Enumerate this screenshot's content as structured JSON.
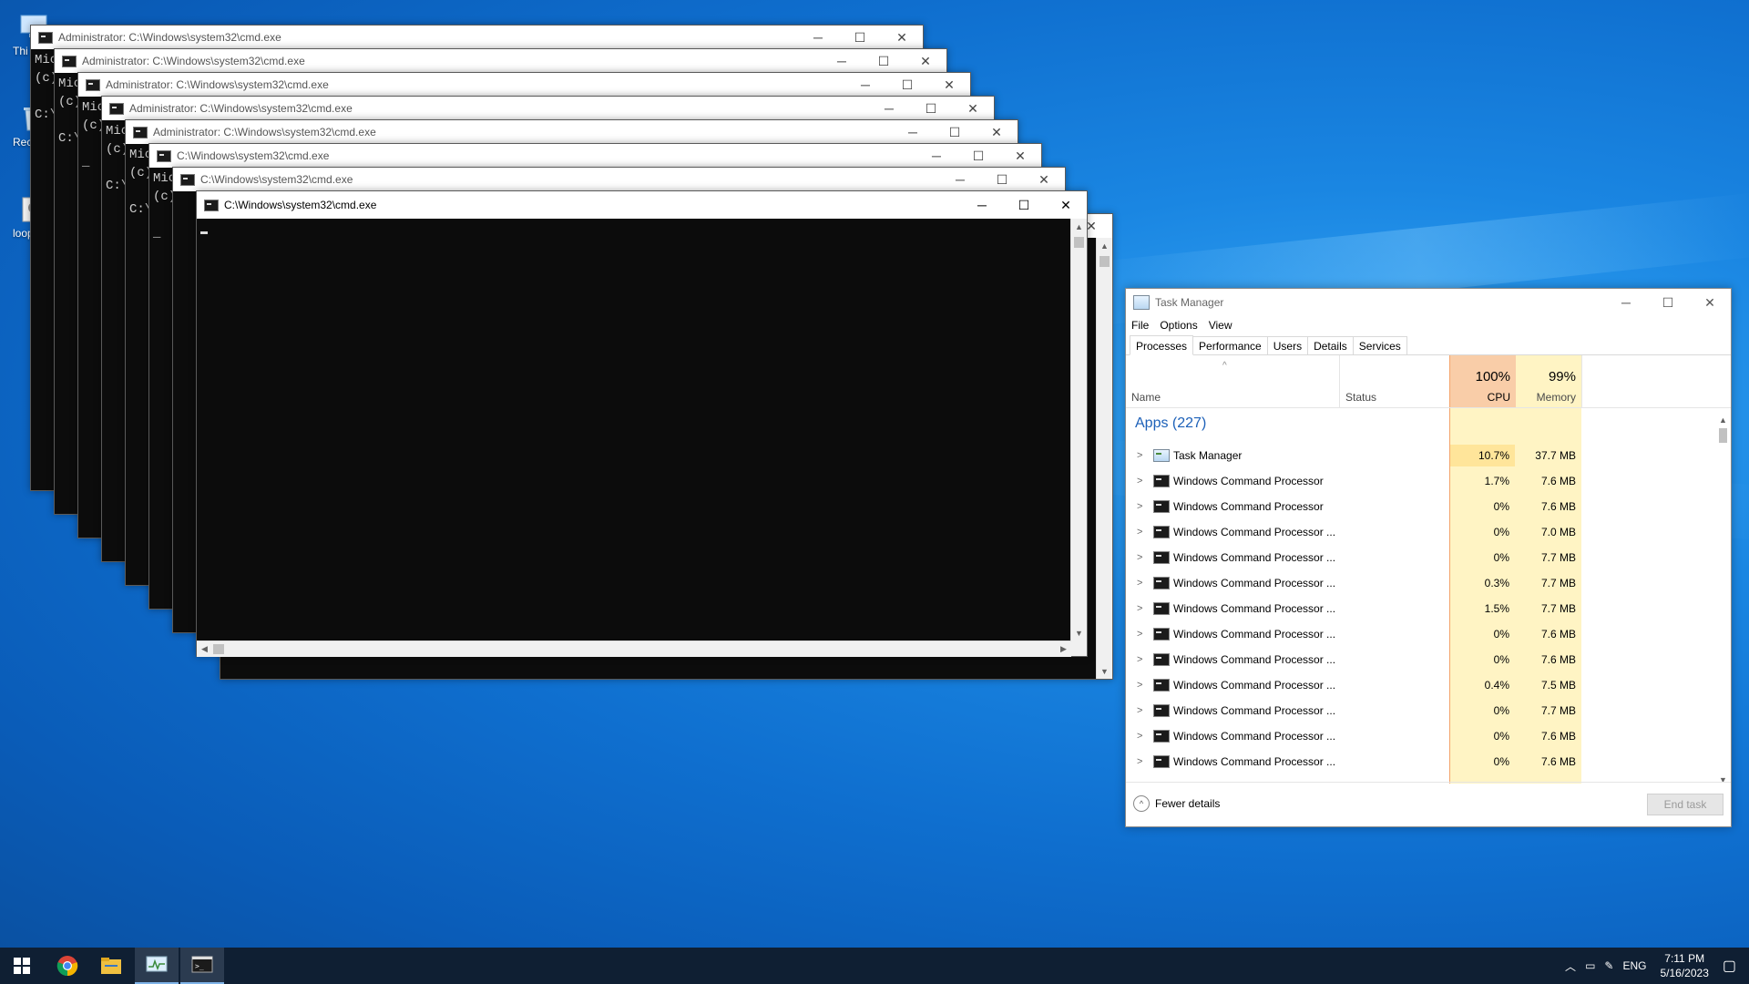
{
  "desktop_icons": [
    {
      "label": "Thi",
      "icon": "this-pc-icon"
    },
    {
      "label": "Recy",
      "icon": "recycle-bin-icon"
    },
    {
      "label": "loop",
      "icon": "file-icon"
    }
  ],
  "cmd_windows": [
    {
      "title": "Administrator: C:\\Windows\\system32\\cmd.exe",
      "lines": [
        "Mic",
        "(c)",
        "",
        "C:\\"
      ]
    },
    {
      "title": "Administrator: C:\\Windows\\system32\\cmd.exe",
      "lines": [
        "Mic",
        "(c)",
        "",
        "C:\\"
      ]
    },
    {
      "title": "Administrator: C:\\Windows\\system32\\cmd.exe",
      "lines": [
        "Mic",
        "(c)",
        "",
        "_"
      ]
    },
    {
      "title": "Administrator: C:\\Windows\\system32\\cmd.exe",
      "lines": [
        "Mic",
        "(c)",
        "",
        "C:\\"
      ]
    },
    {
      "title": "Administrator: C:\\Windows\\system32\\cmd.exe",
      "lines": [
        "Mic",
        "(c)",
        "",
        "C:\\"
      ]
    },
    {
      "title": "C:\\Windows\\system32\\cmd.exe",
      "lines": [
        "Mic",
        "(c)",
        "",
        "_"
      ]
    },
    {
      "title": "C:\\Windows\\system32\\cmd.exe",
      "lines": []
    },
    {
      "title": "C:\\Windows\\system32\\cmd.exe",
      "lines": []
    }
  ],
  "task_manager": {
    "title": "Task Manager",
    "menu": [
      "File",
      "Options",
      "View"
    ],
    "tabs": [
      "Processes",
      "Performance",
      "Users",
      "Details",
      "Services"
    ],
    "active_tab": "Processes",
    "columns": {
      "name": "Name",
      "status": "Status",
      "cpu": "CPU",
      "memory": "Memory"
    },
    "cpu_total": "100%",
    "memory_total": "99%",
    "group_label": "Apps (227)",
    "rows": [
      {
        "name": "Task Manager",
        "cpu": "10.7%",
        "memory": "37.7 MB",
        "icon": "task-manager-icon"
      },
      {
        "name": "Windows Command Processor",
        "cpu": "1.7%",
        "memory": "7.6 MB",
        "icon": "cmd-icon"
      },
      {
        "name": "Windows Command Processor",
        "cpu": "0%",
        "memory": "7.6 MB",
        "icon": "cmd-icon"
      },
      {
        "name": "Windows Command Processor ...",
        "cpu": "0%",
        "memory": "7.0 MB",
        "icon": "cmd-icon"
      },
      {
        "name": "Windows Command Processor ...",
        "cpu": "0%",
        "memory": "7.7 MB",
        "icon": "cmd-icon"
      },
      {
        "name": "Windows Command Processor ...",
        "cpu": "0.3%",
        "memory": "7.7 MB",
        "icon": "cmd-icon"
      },
      {
        "name": "Windows Command Processor ...",
        "cpu": "1.5%",
        "memory": "7.7 MB",
        "icon": "cmd-icon"
      },
      {
        "name": "Windows Command Processor ...",
        "cpu": "0%",
        "memory": "7.6 MB",
        "icon": "cmd-icon"
      },
      {
        "name": "Windows Command Processor ...",
        "cpu": "0%",
        "memory": "7.6 MB",
        "icon": "cmd-icon"
      },
      {
        "name": "Windows Command Processor ...",
        "cpu": "0.4%",
        "memory": "7.5 MB",
        "icon": "cmd-icon"
      },
      {
        "name": "Windows Command Processor ...",
        "cpu": "0%",
        "memory": "7.7 MB",
        "icon": "cmd-icon"
      },
      {
        "name": "Windows Command Processor ...",
        "cpu": "0%",
        "memory": "7.6 MB",
        "icon": "cmd-icon"
      },
      {
        "name": "Windows Command Processor ...",
        "cpu": "0%",
        "memory": "7.6 MB",
        "icon": "cmd-icon"
      }
    ],
    "fewer_details": "Fewer details",
    "end_task": "End task"
  },
  "taskbar": {
    "apps": [
      "start-icon",
      "chrome-icon",
      "file-explorer-icon",
      "task-manager-icon",
      "cmd-icon"
    ],
    "language": "ENG",
    "time": "7:11 PM",
    "date": "5/16/2023"
  },
  "colors": {
    "cpu_header": "#f9cda8",
    "heat_light": "#fff4c4",
    "heat_mid": "#ffe59a",
    "accent": "#1c60b8"
  }
}
